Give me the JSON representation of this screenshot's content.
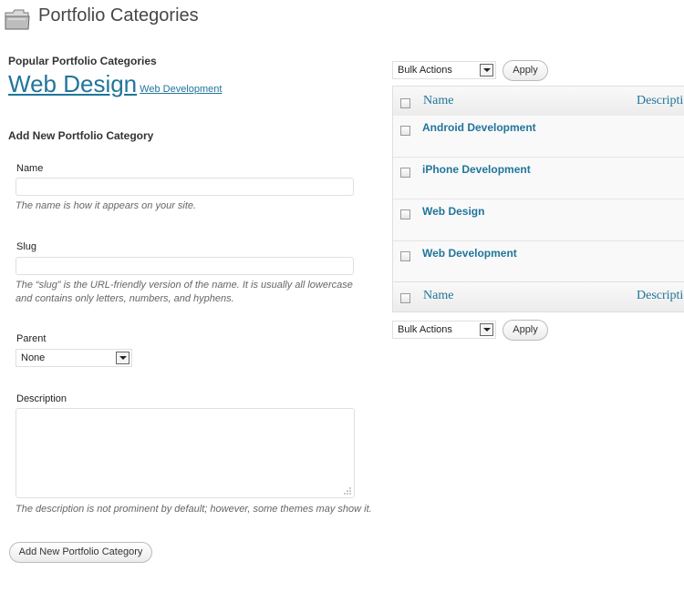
{
  "page": {
    "title": "Portfolio Categories"
  },
  "popular": {
    "heading": "Popular Portfolio Categories",
    "tags": [
      "Web Design",
      "Web Development"
    ]
  },
  "form": {
    "heading": "Add New Portfolio Category",
    "name_label": "Name",
    "name_value": "",
    "name_help": "The name is how it appears on your site.",
    "slug_label": "Slug",
    "slug_value": "",
    "slug_help_line1": "The “slug” is the URL-friendly version of the name. It is usually all lowercase",
    "slug_help_line2": "and contains only letters, numbers, and hyphens.",
    "parent_label": "Parent",
    "parent_selected": "None",
    "description_label": "Description",
    "description_value": "",
    "description_help": "The description is not prominent by default; however, some themes may show it.",
    "submit_label": "Add New Portfolio Category"
  },
  "table": {
    "bulk_top": {
      "selected": "Bulk Actions",
      "apply": "Apply"
    },
    "bulk_bottom": {
      "selected": "Bulk Actions",
      "apply": "Apply"
    },
    "columns": {
      "name": "Name",
      "description": "Description"
    },
    "rows": [
      {
        "name": "Android Development"
      },
      {
        "name": "iPhone Development"
      },
      {
        "name": "Web Design"
      },
      {
        "name": "Web Development"
      }
    ]
  },
  "colors": {
    "link": "#21759b",
    "text": "#333333",
    "border": "#dfdfdf"
  },
  "icons": {
    "page_icon": "folder-icon",
    "select_arrow": "chevron-down-icon"
  }
}
